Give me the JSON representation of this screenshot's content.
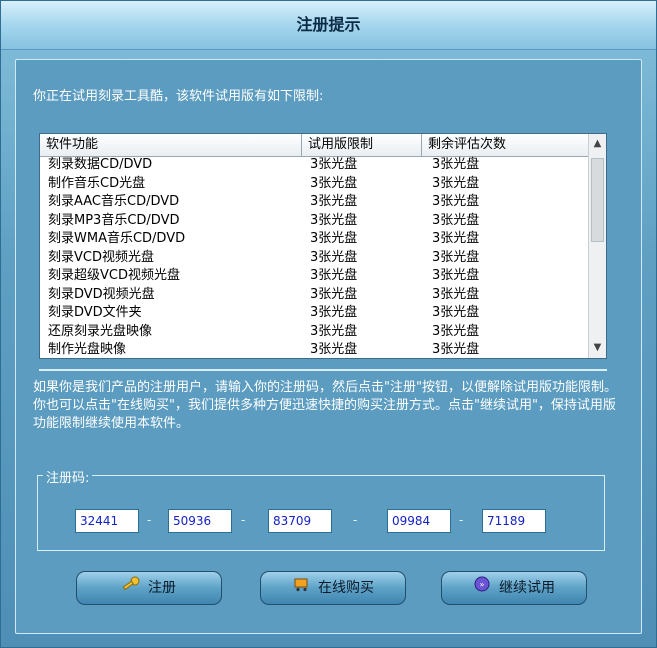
{
  "window": {
    "title": "注册提示"
  },
  "intro": "你正在试用刻录工具酷，该软件试用版有如下限制:",
  "list": {
    "headers": [
      "软件功能",
      "试用版限制",
      "剩余评估次数"
    ],
    "rows": [
      [
        "刻录数据CD/DVD",
        "3张光盘",
        "3张光盘"
      ],
      [
        "制作音乐CD光盘",
        "3张光盘",
        "3张光盘"
      ],
      [
        "刻录AAC音乐CD/DVD",
        "3张光盘",
        "3张光盘"
      ],
      [
        "刻录MP3音乐CD/DVD",
        "3张光盘",
        "3张光盘"
      ],
      [
        "刻录WMA音乐CD/DVD",
        "3张光盘",
        "3张光盘"
      ],
      [
        "刻录VCD视频光盘",
        "3张光盘",
        "3张光盘"
      ],
      [
        "刻录超级VCD视频光盘",
        "3张光盘",
        "3张光盘"
      ],
      [
        "刻录DVD视频光盘",
        "3张光盘",
        "3张光盘"
      ],
      [
        "刻录DVD文件夹",
        "3张光盘",
        "3张光盘"
      ],
      [
        "还原刻录光盘映像",
        "3张光盘",
        "3张光盘"
      ],
      [
        "制作光盘映像",
        "3张光盘",
        "3张光盘"
      ]
    ]
  },
  "info": "如果你是我们产品的注册用户，请输入你的注册码，然后点击\"注册\"按钮，以便解除试用版功能限制。你也可以点击\"在线购买\"，我们提供多种方便迅速快捷的购买注册方式。点击\"继续试用\"，保持试用版功能限制继续使用本软件。",
  "registration": {
    "label": "注册码:",
    "codes": [
      "32441",
      "50936",
      "83709",
      "09984",
      "71189"
    ]
  },
  "buttons": {
    "register": "注册",
    "buy": "在线购买",
    "continue": "继续试用"
  },
  "icons": {
    "register": "key-icon",
    "buy": "cart-icon",
    "continue": "play-circle-icon"
  }
}
